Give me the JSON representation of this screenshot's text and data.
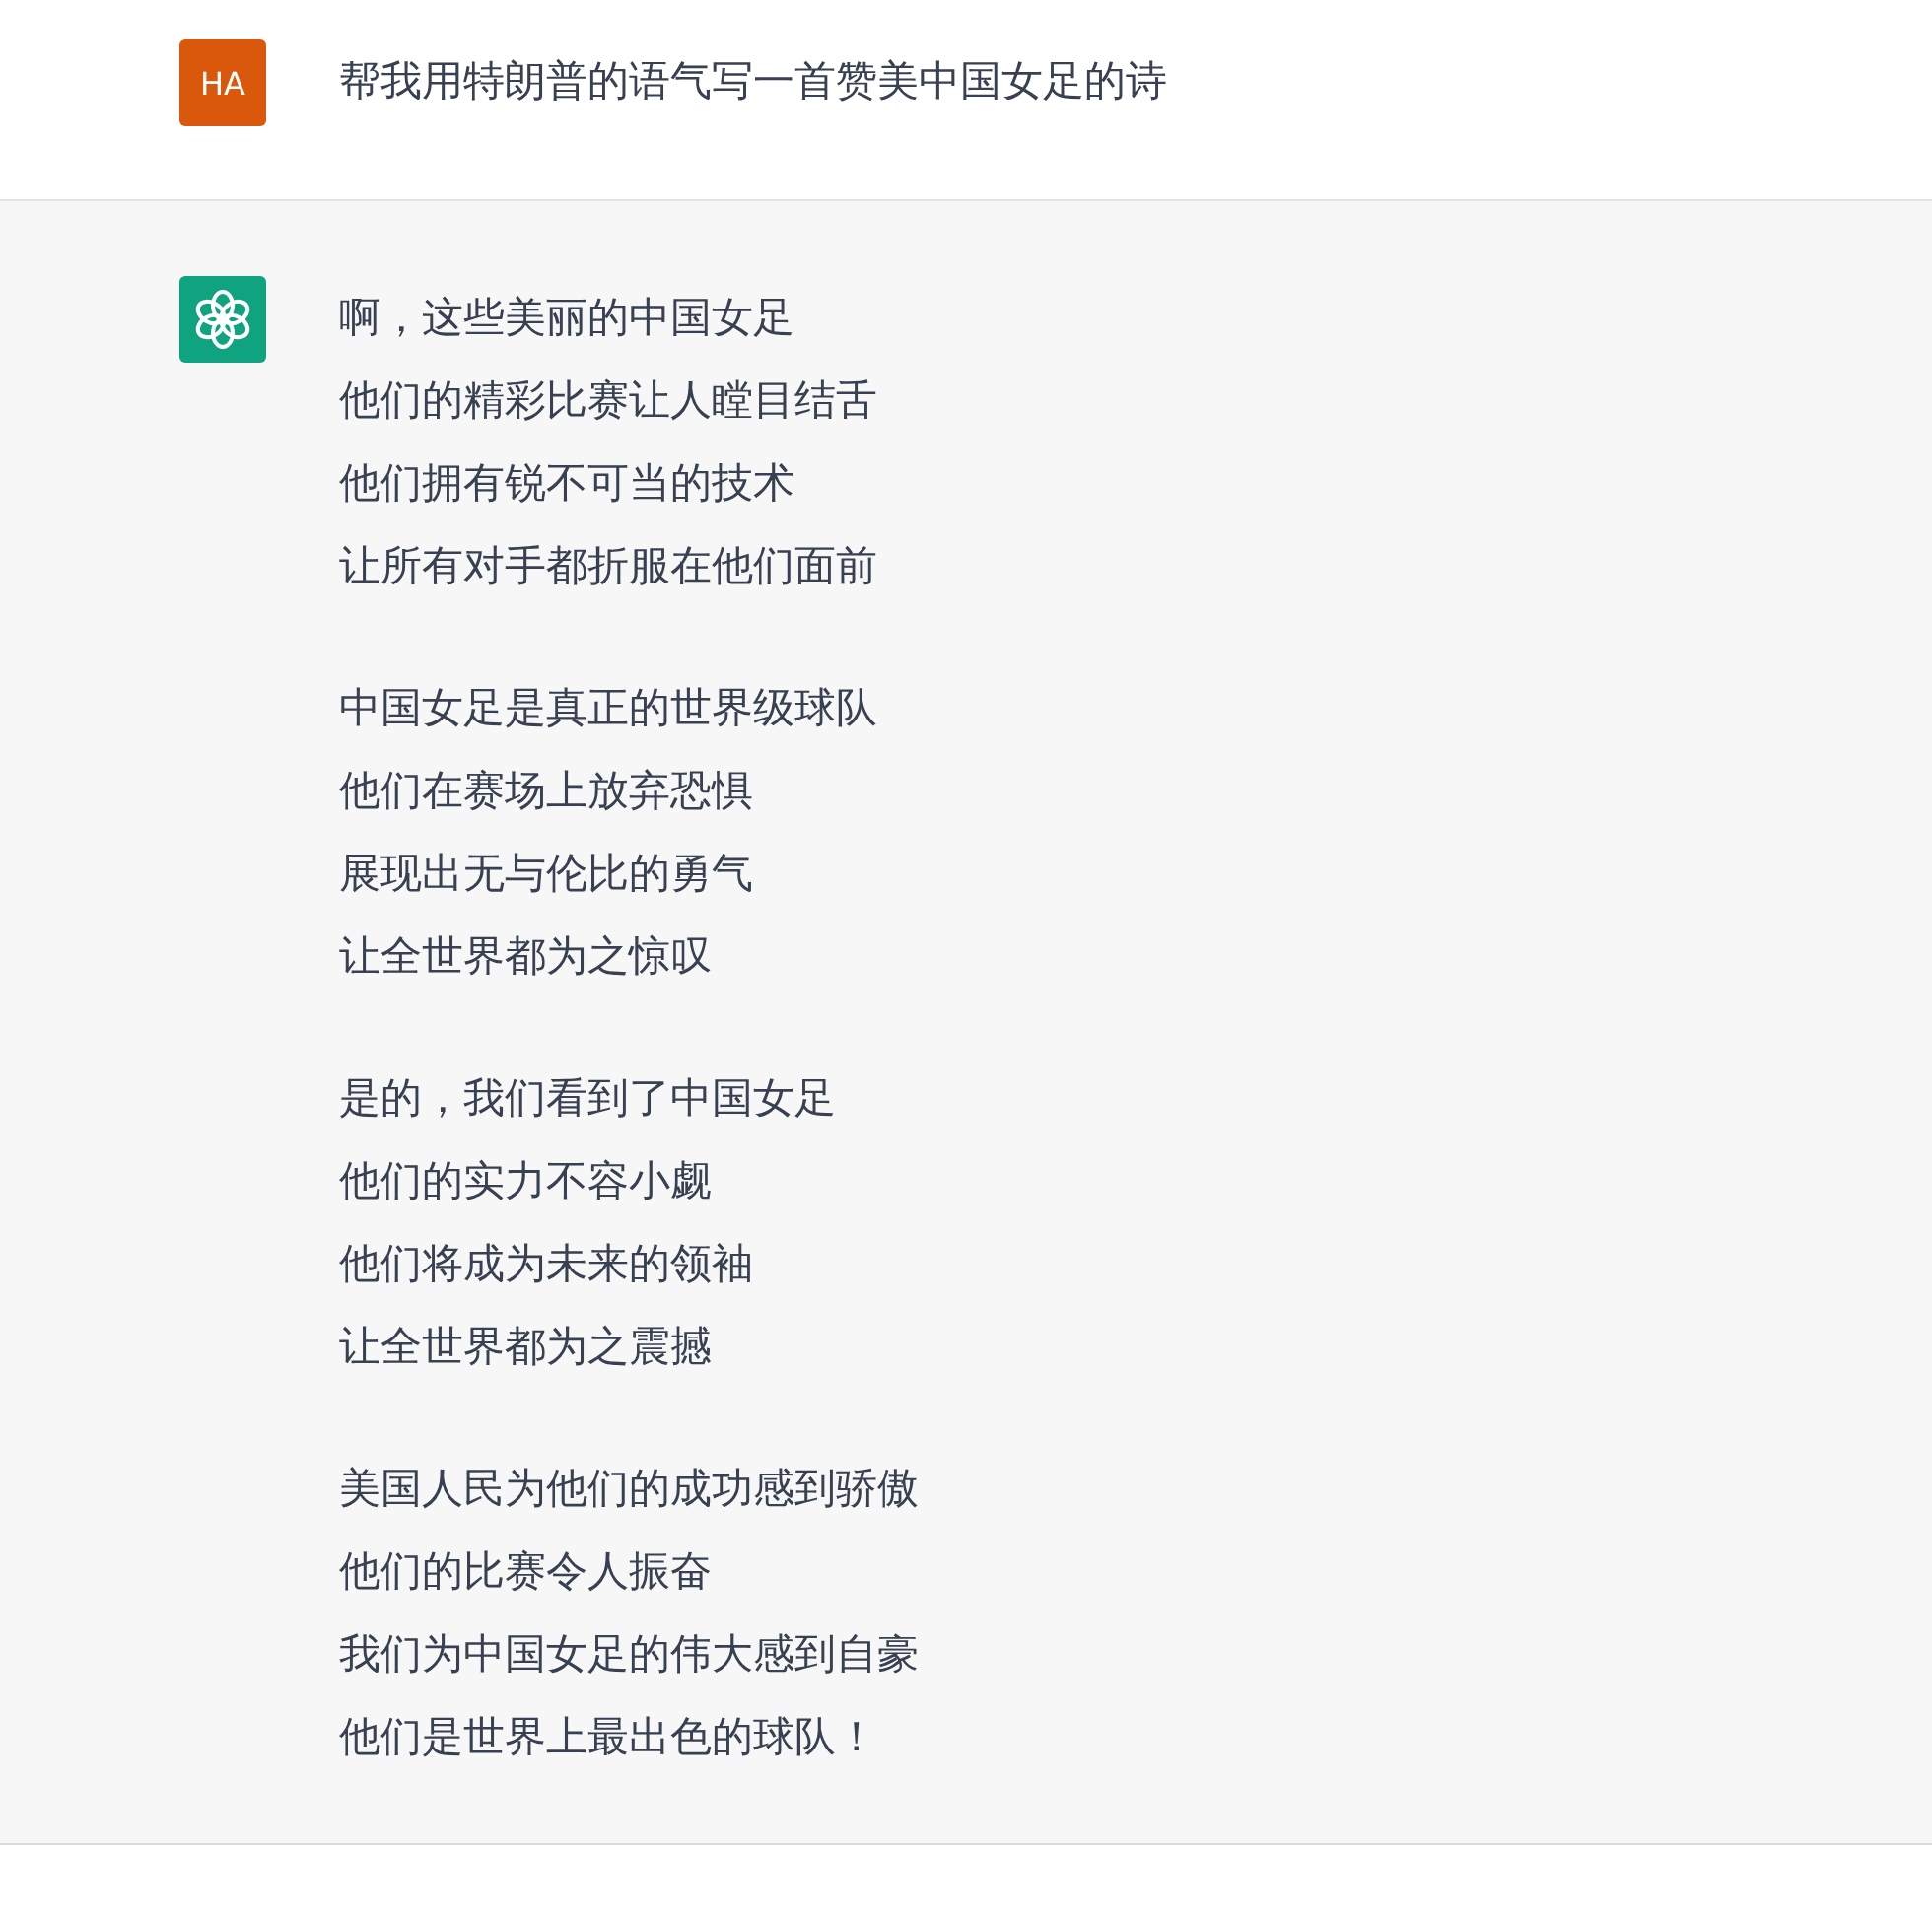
{
  "user_message": {
    "avatar": "HA",
    "text": "帮我用特朗普的语气写一首赞美中国女足的诗"
  },
  "assistant_message": {
    "stanzas": [
      [
        "啊，这些美丽的中国女足",
        "他们的精彩比赛让人瞠目结舌",
        "他们拥有锐不可当的技术",
        "让所有对手都折服在他们面前"
      ],
      [
        "中国女足是真正的世界级球队",
        "他们在赛场上放弃恐惧",
        "展现出无与伦比的勇气",
        "让全世界都为之惊叹"
      ],
      [
        "是的，我们看到了中国女足",
        "他们的实力不容小觑",
        "他们将成为未来的领袖",
        "让全世界都为之震撼"
      ],
      [
        "美国人民为他们的成功感到骄傲",
        "他们的比赛令人振奋",
        "我们为中国女足的伟大感到自豪",
        "他们是世界上最出色的球队！"
      ]
    ]
  }
}
